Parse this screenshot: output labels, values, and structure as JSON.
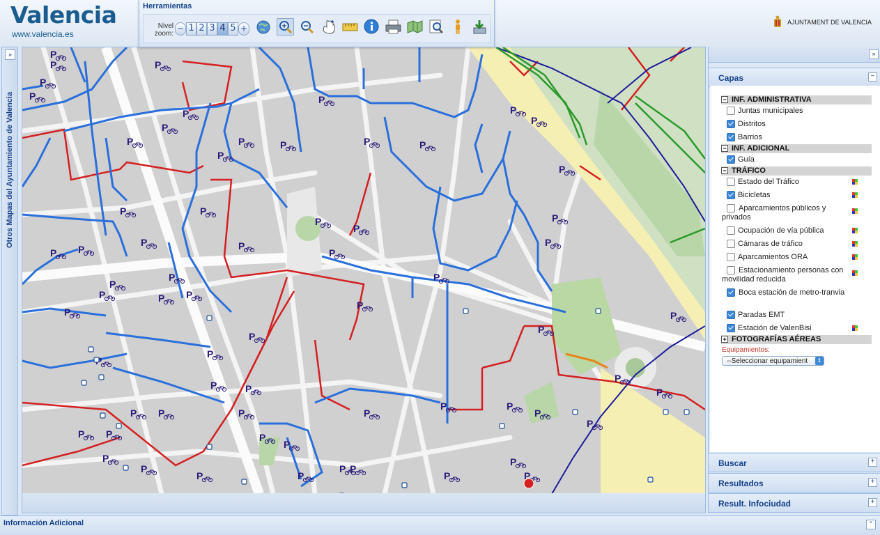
{
  "header": {
    "title": "Valencia",
    "url": "www.valencia.es",
    "council": "AJUNTAMENT DE VALENCIA"
  },
  "toolbar": {
    "title": "Herramientas",
    "zoom_label_1": "Nivel",
    "zoom_label_2": "zoom:",
    "zoom_minus": "−",
    "zoom_levels": [
      "1",
      "2",
      "3",
      "4",
      "5"
    ],
    "zoom_active": "4",
    "zoom_plus": "+",
    "tools": [
      "globe-icon",
      "zoom-in-icon",
      "zoom-out-icon",
      "pan-hand-icon",
      "measure-icon",
      "info-icon",
      "print-icon",
      "overview-map-icon",
      "search-area-icon",
      "person-icon",
      "download-icon"
    ]
  },
  "left_sidebar": {
    "label": "Otros Mapas del Ayuntamiento de Valencia",
    "expand": "»"
  },
  "right_panel": {
    "expand": "»",
    "capas": {
      "title": "Capas",
      "toggle": "−",
      "groups": [
        {
          "label": "INF. ADMINISTRATIVA",
          "toggle": "−"
        },
        {
          "label": "INF. ADICIONAL",
          "toggle": "−"
        },
        {
          "label": "TRÁFICO",
          "toggle": "−"
        },
        {
          "label": "FOTOGRAFÍAS AÉREAS",
          "toggle": "+"
        }
      ],
      "items": [
        {
          "label": "Juntas municipales",
          "checked": false
        },
        {
          "label": "Distritos",
          "checked": true
        },
        {
          "label": "Barrios",
          "checked": true
        },
        {
          "label": "Guía",
          "checked": true
        },
        {
          "label": "Estado del Tráfico",
          "checked": false
        },
        {
          "label": "Bicicletas",
          "checked": true
        },
        {
          "label": "Aparcamientos públicos y privados",
          "checked": false
        },
        {
          "label": "Ocupación de vía pública",
          "checked": false
        },
        {
          "label": "Cámaras de tráfico",
          "checked": false
        },
        {
          "label": "Aparcamientos ORA",
          "checked": false
        },
        {
          "label": "Estacionamiento personas con movilidad reducida",
          "checked": false
        },
        {
          "label": "Boca estación de metro-tranvia",
          "checked": true
        },
        {
          "label": "Paradas EMT",
          "checked": true
        },
        {
          "label": "Estación de ValenBisi",
          "checked": true
        }
      ],
      "equipamientos_label": "Equipamientos:",
      "equipamientos_select": "--Seleccionar equipamient"
    },
    "buscar": "Buscar",
    "resultados": "Resultados",
    "result_infociudad": "Result. Infociudad",
    "collapsed_toggle": "+"
  },
  "bottom": {
    "label": "Información Adicional",
    "toggle": "⌃"
  },
  "map": {
    "parking_letter": "P",
    "colors": {
      "bike_lane": "#2a6fdb",
      "red_route": "#d42020",
      "navy_route": "#1c1c9c",
      "green_route": "#2a9a2a",
      "parking": "#2a1d7a"
    }
  }
}
